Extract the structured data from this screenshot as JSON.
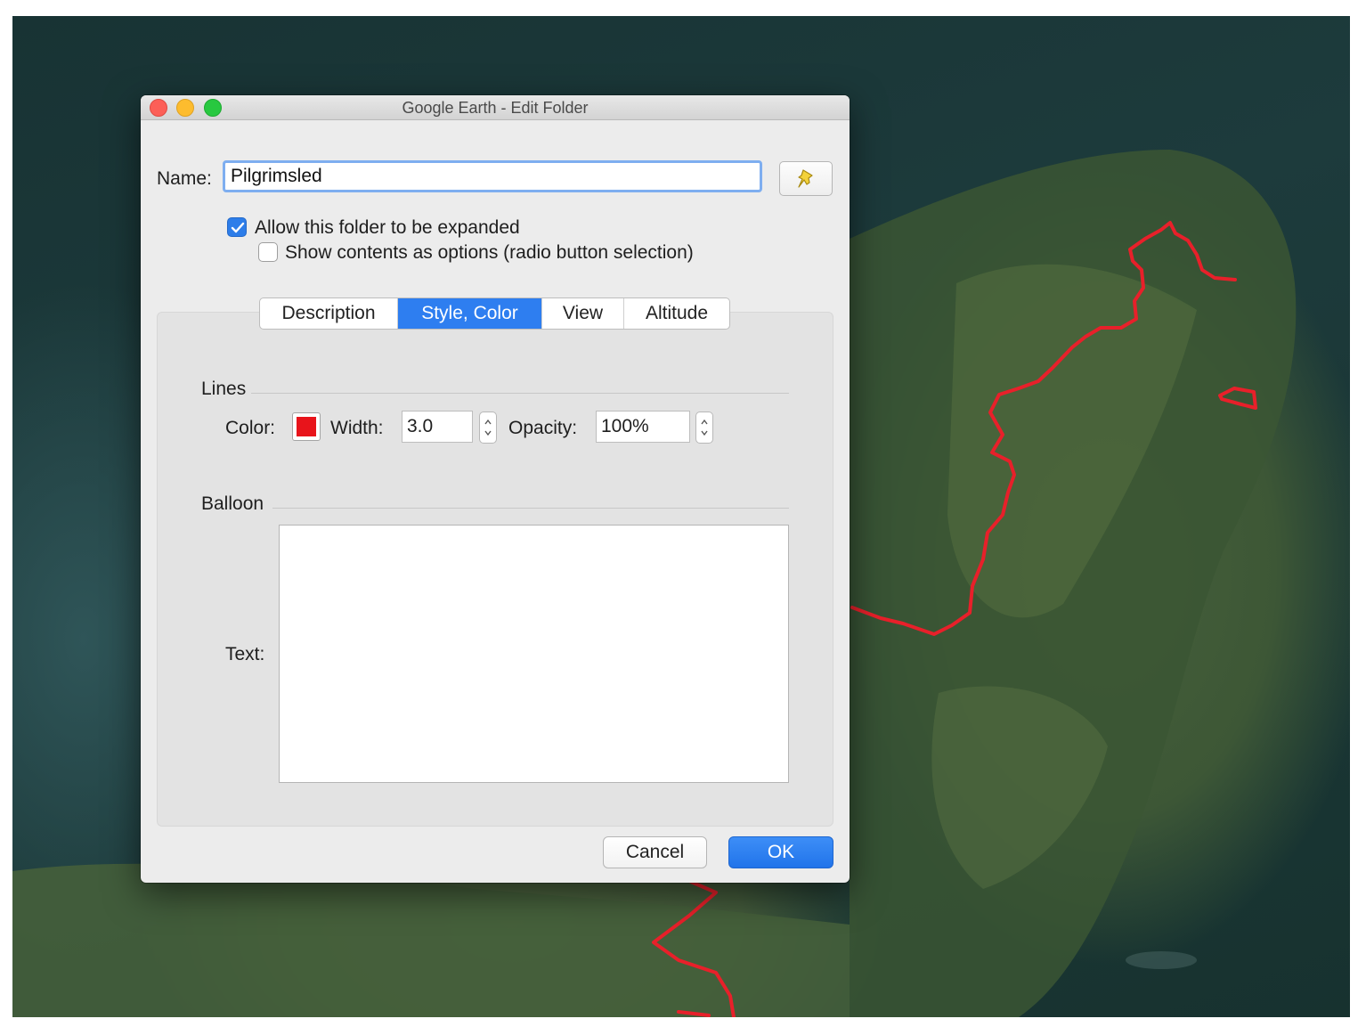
{
  "window": {
    "title": "Google Earth - Edit Folder"
  },
  "name": {
    "label": "Name:",
    "value": "Pilgrimsled"
  },
  "options": [
    {
      "label": "Allow this folder to be expanded",
      "checked": true
    },
    {
      "label": "Show contents as options (radio button selection)",
      "checked": false
    }
  ],
  "tabs": [
    {
      "label": "Description",
      "active": false
    },
    {
      "label": "Style, Color",
      "active": true
    },
    {
      "label": "View",
      "active": false
    },
    {
      "label": "Altitude",
      "active": false
    }
  ],
  "lines": {
    "section_title": "Lines",
    "color_label": "Color:",
    "color_value": "#e8141b",
    "width_label": "Width:",
    "width_value": "3.0",
    "opacity_label": "Opacity:",
    "opacity_value": "100%"
  },
  "balloon": {
    "section_title": "Balloon",
    "text_label": "Text:",
    "text_value": ""
  },
  "buttons": {
    "cancel": "Cancel",
    "ok": "OK"
  },
  "colors": {
    "accent": "#2e7ef0",
    "trail": "#e8202a"
  }
}
